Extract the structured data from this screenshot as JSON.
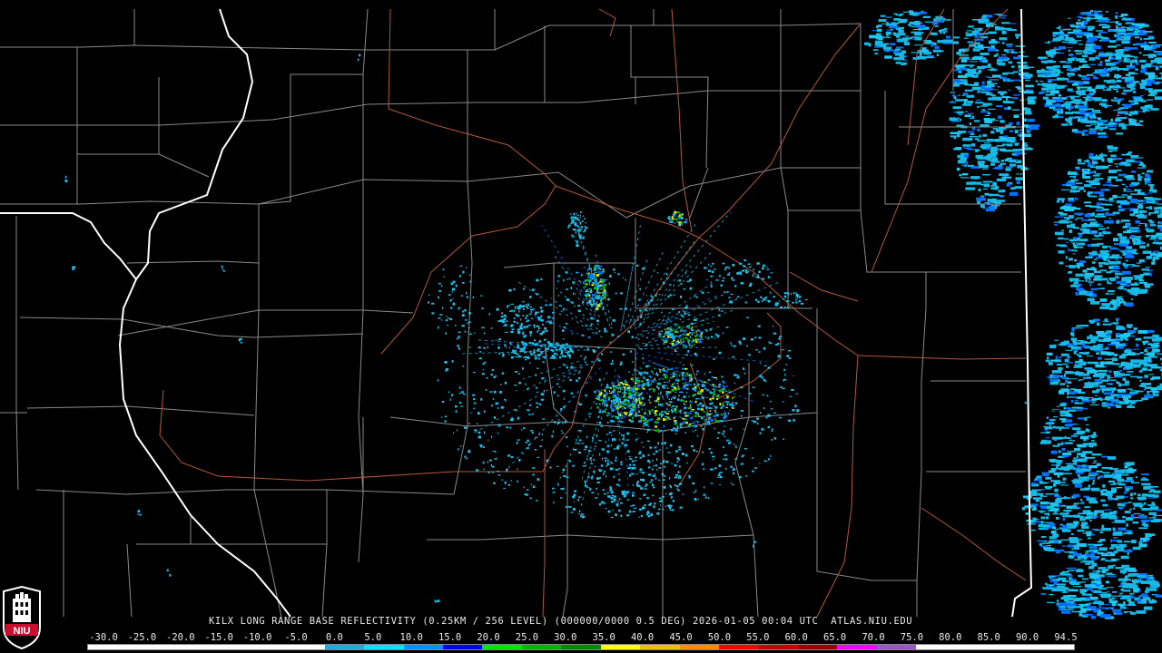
{
  "caption": {
    "text": "KILX LONG RANGE BASE REFLECTIVITY (0.25KM / 256 LEVEL) (000000/0000 0.5 DEG) 2026-01-05 00:04 UTC  ATLAS.NIU.EDU"
  },
  "scale": {
    "labels": [
      "-30.0",
      "-25.0",
      "-20.0",
      "-15.0",
      "-10.0",
      "-5.0",
      "0.0",
      "5.0",
      "10.0",
      "15.0",
      "20.0",
      "25.0",
      "30.0",
      "35.0",
      "40.0",
      "45.0",
      "50.0",
      "55.0",
      "60.0",
      "65.0",
      "70.0",
      "75.0",
      "80.0",
      "85.0",
      "90.0",
      "94.5"
    ],
    "colors": [
      "#ffffff",
      "#ffffff",
      "#ffffff",
      "#ffffff",
      "#ffffff",
      "#ffffff",
      "#24a6d8",
      "#00e4ff",
      "#0090ff",
      "#0000ff",
      "#00e600",
      "#00b400",
      "#008800",
      "#ffff00",
      "#f0c000",
      "#ff8c00",
      "#ff0000",
      "#c80000",
      "#a00000",
      "#ff00ff",
      "#9a55c8",
      "#ffffff",
      "#ffffff",
      "#ffffff",
      "#ffffff"
    ]
  },
  "map_colors": {
    "background": "#000000",
    "county_lines": "#8a8a8a",
    "state_lines": "#ffffff",
    "roads": "#b4583a",
    "echo_light": "#16b8e6",
    "echo_mid": "#0072ff",
    "echo_heavy": "#00c800",
    "echo_peak": "#e6e600"
  },
  "logo": {
    "text": "NIU",
    "color": "#c8102e"
  }
}
